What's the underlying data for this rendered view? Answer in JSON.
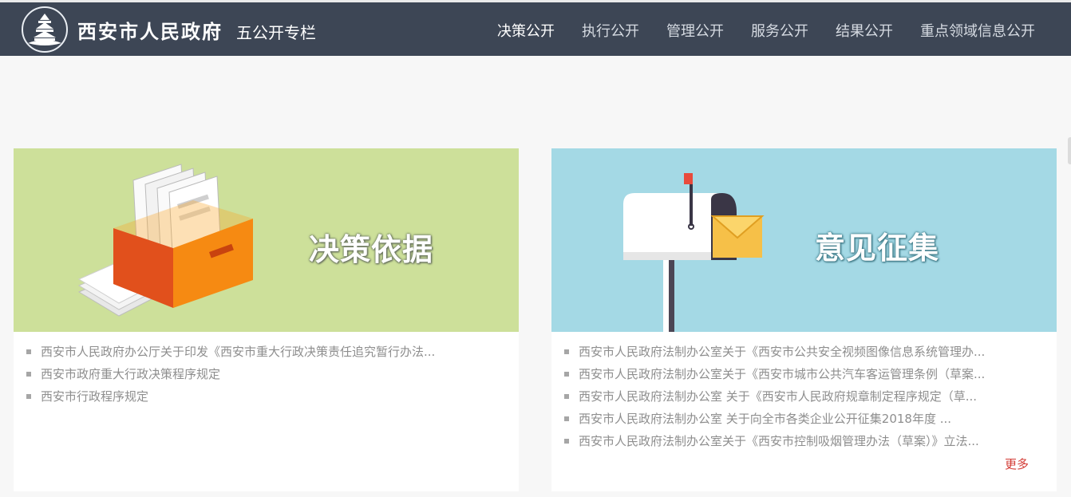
{
  "header": {
    "site_name": "西安市人民政府",
    "column_title": "五公开专栏",
    "nav": [
      {
        "label": "决策公开",
        "active": true
      },
      {
        "label": "执行公开",
        "active": false
      },
      {
        "label": "管理公开",
        "active": false
      },
      {
        "label": "服务公开",
        "active": false
      },
      {
        "label": "结果公开",
        "active": false
      },
      {
        "label": "重点领域信息公开",
        "active": false
      }
    ]
  },
  "sections": {
    "decision_basis": {
      "title": "决策依据",
      "items": [
        "西安市人民政府办公厅关于印发《西安市重大行政决策责任追究暂行办法...",
        "西安市政府重大行政决策程序规定",
        "西安市行政程序规定"
      ]
    },
    "opinion_collection": {
      "title": "意见征集",
      "items": [
        "西安市人民政府法制办公室关于《西安市公共安全视频图像信息系统管理办...",
        "西安市人民政府法制办公室关于《西安市城市公共汽车客运管理条例（草案...",
        "西安市人民政府法制办公室 关于《西安市人民政府规章制定程序规定（草...",
        "西安市人民政府法制办公室 关于向全市各类企业公开征集2018年度 ...",
        "西安市人民政府法制办公室关于《西安市控制吸烟管理办法（草案）》立法..."
      ],
      "more_label": "更多"
    }
  },
  "colors": {
    "topbar": "#3d4655",
    "green_banner": "#cde09a",
    "blue_banner": "#a4d9e5",
    "more_link": "#d33b35"
  }
}
